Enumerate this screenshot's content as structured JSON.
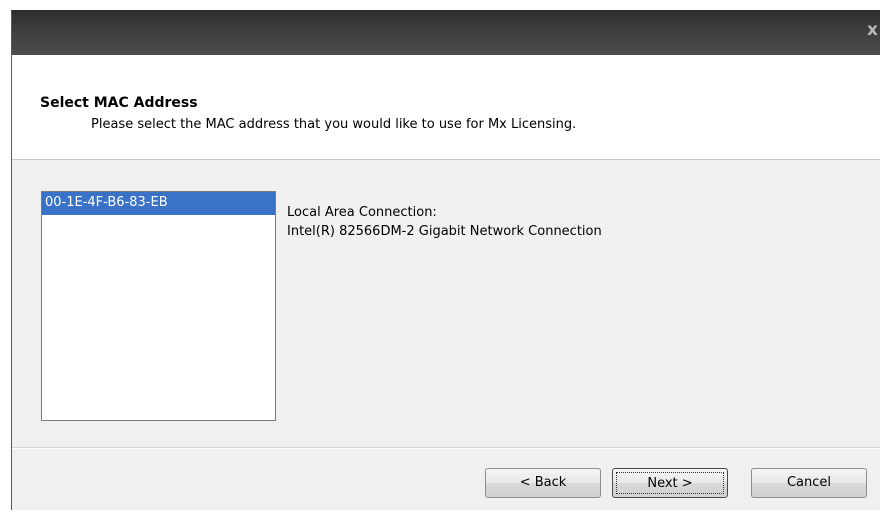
{
  "titlebar": {
    "close_label": "x"
  },
  "header": {
    "title": "Select MAC Address",
    "subtitle": "Please select the MAC address that you would like to use for Mx Licensing."
  },
  "mac_list": {
    "items": [
      {
        "label": "00-1E-4F-B6-83-EB",
        "selected": true
      }
    ]
  },
  "details": {
    "connection_name": "Local Area Connection:",
    "adapter_name": "Intel(R) 82566DM-2 Gigabit Network Connection"
  },
  "buttons": {
    "back_label": "< Back",
    "next_label": "Next >",
    "cancel_label": "Cancel"
  },
  "colors": {
    "selection": "#3a72c8",
    "titlebar": "#3a3a3a",
    "dialog_background": "#f0f0f0"
  }
}
